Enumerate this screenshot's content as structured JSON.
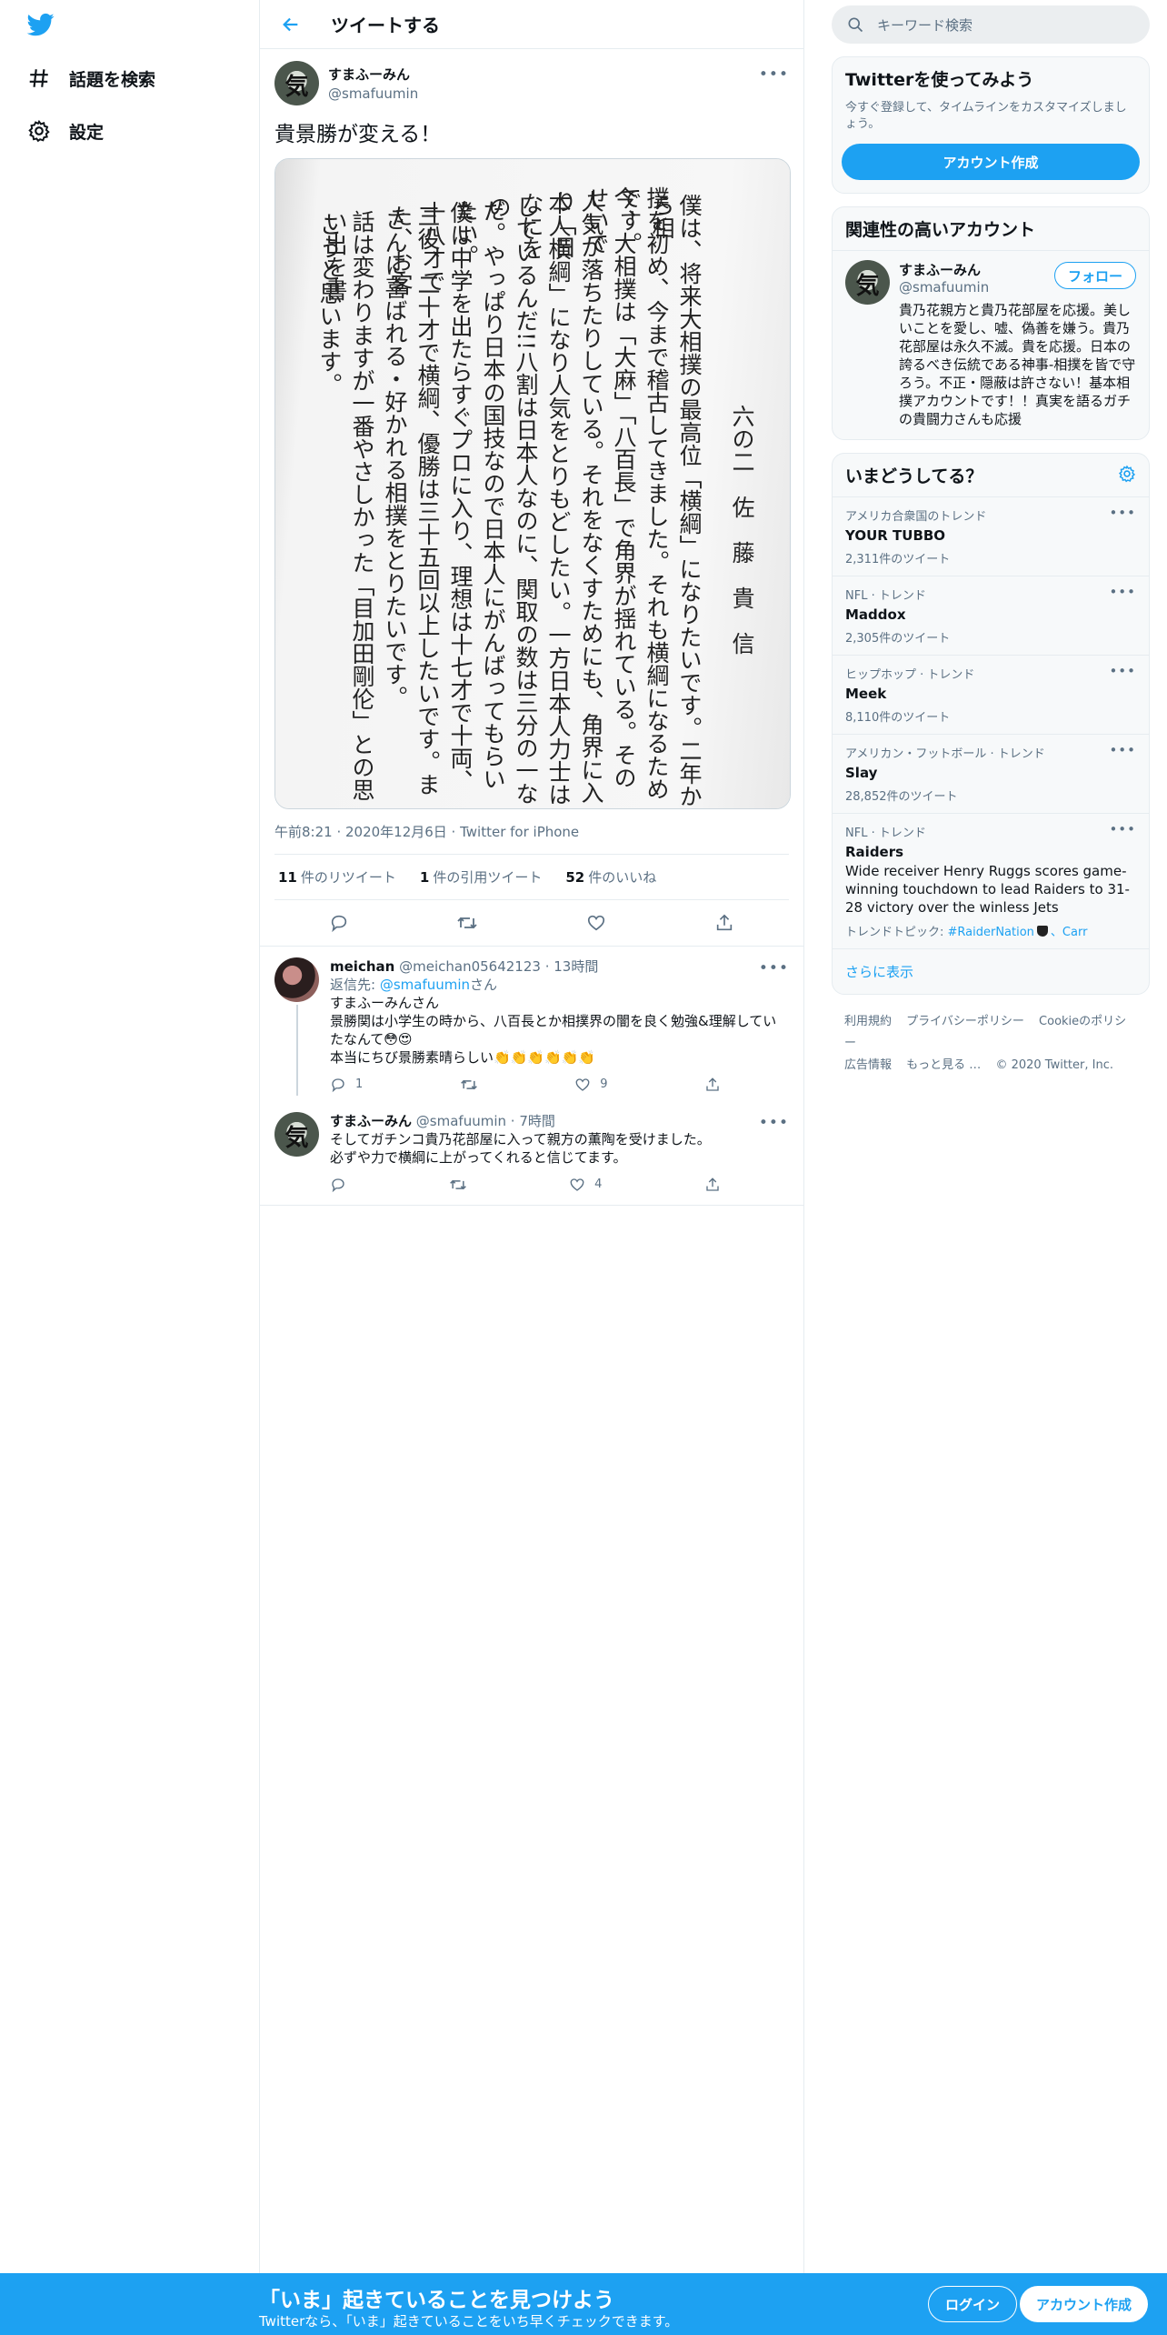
{
  "nav": {
    "explore_label": "話題を検索",
    "settings_label": "設定"
  },
  "header": {
    "title": "ツイートする"
  },
  "tweet": {
    "name": "すまふーみん",
    "handle": "@smafuumin",
    "text": "貴景勝が変える！",
    "meta": "午前8:21 · 2020年12月6日 · Twitter for iPhone",
    "stats": {
      "retweets": "11",
      "retweets_label": "件のリツイート",
      "quotes": "1",
      "quotes_label": "件の引用ツイート",
      "likes": "52",
      "likes_label": "件のいいね"
    },
    "image_text": {
      "col1": "六の二　佐　藤　貴　信",
      "col2": "僕は、将来大相撲の最高位「横綱」になりたいです。二年から相",
      "col3": "撲を初め、今まで稽古してきました。それも横綱になるためです。",
      "col4": "今、大相撲は「大麻」「八百長」で角界が揺れている。そのせいで",
      "col5": "人気が落ちたりしている。それをなくすためにも、角界に入り「日",
      "col6": "本人横綱」になり人気をとりもどしたい。一方日本人力士はなにを",
      "col7": "しているんだ!!八割は日本人なのに、関取の数は三分の一なの",
      "col8": "だ。やっぱり日本の国技なので日本人にがんばってもらいたい。",
      "col9": "僕は中学を出たらすぐプロに入り、理想は十七才で十両、十八才で",
      "col10": "三役、二十才で横綱、優勝は三十五回以上したいです。また、お客",
      "col11": "さんに喜ばれる・好かれる相撲をとりたいです。",
      "col12": "話は変わりますが一番やさしかった「目加田剛伦」との思い出を書",
      "col13": "こうと思います。"
    }
  },
  "replies": [
    {
      "name": "meichan",
      "handle": "@meichan05642123",
      "time": "· 13時間",
      "to_label": "返信先: ",
      "to_handle": "@smafuumin",
      "to_suffix": "さん",
      "text": "すまふーみんさん\n景勝関は小学生の時から、八百長とか相撲界の闇を良く勉強&理解していたなんて😳😍\n本当にちび景勝素晴らしい👏👏👏👏👏👏",
      "replies": "1",
      "likes": "9"
    },
    {
      "name": "すまふーみん",
      "handle": "@smafuumin",
      "time": "· 7時間",
      "text": "そしてガチンコ貴乃花部屋に入って親方の薫陶を受けました。\n必ずや力で横綱に上がってくれると信じてます。",
      "replies": "",
      "likes": "4"
    }
  ],
  "sidebar": {
    "search_placeholder": "キーワード検索",
    "signup_card": {
      "title": "Twitterを使ってみよう",
      "subtitle": "今すぐ登録して、タイムラインをカスタマイズしましょう。",
      "button": "アカウント作成"
    },
    "related": {
      "title": "関連性の高いアカウント",
      "name": "すまふーみん",
      "handle": "@smafuumin",
      "follow": "フォロー",
      "bio": "貴乃花親方と貴乃花部屋を応援。美しいことを愛し、嘘、偽善を嫌う。貴乃花部屋は永久不滅。貴を応援。日本の誇るべき伝統である神事-相撲を皆で守ろう。不正・隠蔽は許さない！基本相撲アカウントです！！真実を語るガチの貴闘力さんも応援"
    },
    "trends": {
      "title": "いまどうしてる？",
      "items": [
        {
          "context": "アメリカ合衆国のトレンド",
          "name": "YOUR TUBBO",
          "count": "2,311件のツイート"
        },
        {
          "context": "NFL · トレンド",
          "name": "Maddox",
          "count": "2,305件のツイート"
        },
        {
          "context": "ヒップホップ · トレンド",
          "name": "Meek",
          "count": "8,110件のツイート"
        },
        {
          "context": "アメリカン・フットボール · トレンド",
          "name": "Slay",
          "count": "28,852件のツイート"
        },
        {
          "context": "NFL · トレンド",
          "name": "Raiders",
          "desc": "Wide receiver Henry Ruggs scores game-winning touchdown to lead Raiders to 31-28 victory over the winless Jets",
          "topic_label": "トレンドトピック: ",
          "topic_tag": "#RaiderNation",
          "topic_tail": "、Carr"
        }
      ],
      "show_more": "さらに表示"
    },
    "footer": {
      "terms": "利用規約",
      "privacy": "プライバシーポリシー",
      "cookie": "Cookieのポリシー",
      "ads": "広告情報",
      "more": "もっと見る …",
      "copyright": "© 2020 Twitter, Inc."
    }
  },
  "bottom_bar": {
    "title": "「いま」起きていることを見つけよう",
    "subtitle": "Twitterなら、「いま」起きていることをいち早くチェックできます。",
    "login": "ログイン",
    "signup": "アカウント作成"
  },
  "colors": {
    "accent": "#1da1f2",
    "text_secondary": "#5b7083"
  },
  "icons": [
    "twitter-logo-icon",
    "hashtag-icon",
    "gear-icon",
    "back-arrow-icon",
    "more-icon",
    "reply-icon",
    "retweet-icon",
    "like-icon",
    "share-icon",
    "search-icon"
  ]
}
